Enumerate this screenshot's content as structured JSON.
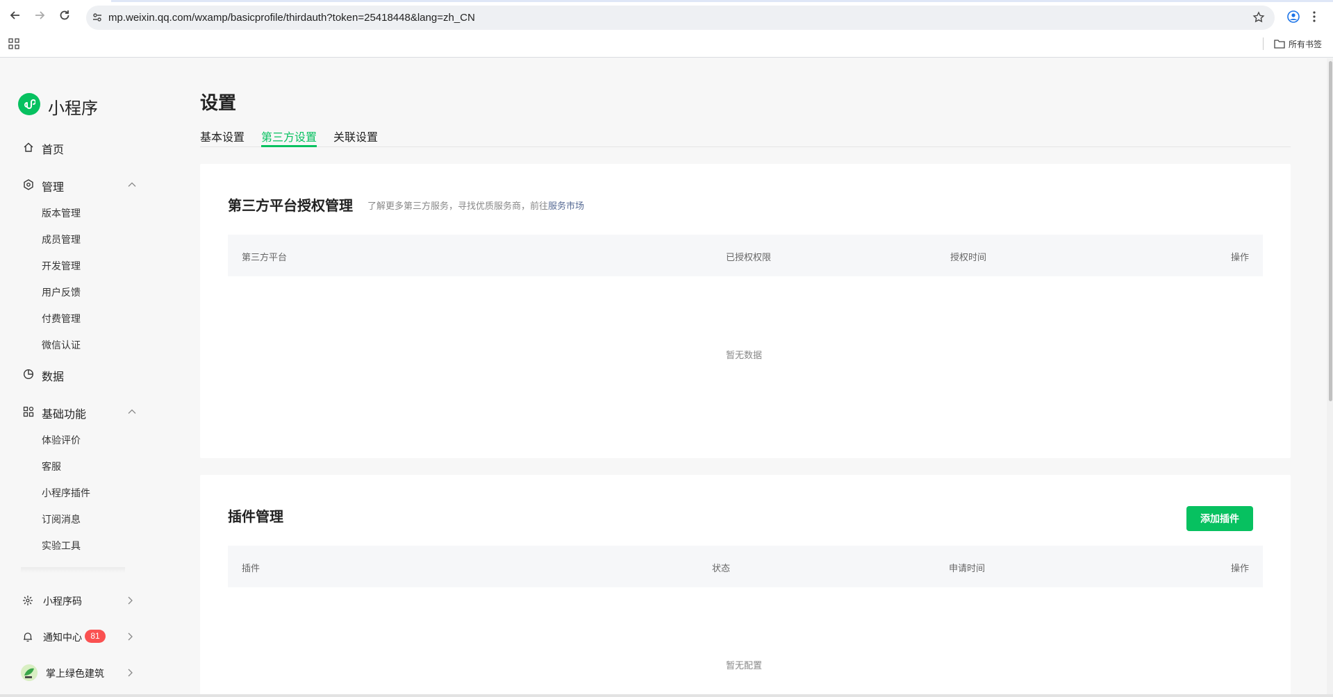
{
  "browser": {
    "url": "mp.weixin.qq.com/wxamp/basicprofile/thirdauth?token=25418448&lang=zh_CN",
    "bookmarks_label": "所有书签"
  },
  "sidebar": {
    "logo_text": "小程序",
    "home": "首页",
    "manage": {
      "label": "管理",
      "items": [
        "版本管理",
        "成员管理",
        "开发管理",
        "用户反馈",
        "付费管理",
        "微信认证"
      ]
    },
    "data": "数据",
    "basic": {
      "label": "基础功能",
      "items": [
        "体验评价",
        "客服",
        "小程序插件",
        "订阅消息",
        "实验工具"
      ]
    },
    "bottom": {
      "qrcode": "小程序码",
      "notify": "通知中心",
      "notify_count": "81",
      "account": "掌上绿色建筑"
    }
  },
  "page": {
    "title": "设置",
    "tabs": [
      "基本设置",
      "第三方设置",
      "关联设置"
    ],
    "active_tab": "第三方设置"
  },
  "third_party": {
    "title": "第三方平台授权管理",
    "desc": "了解更多第三方服务，寻找优质服务商，前往",
    "desc_link": "服务市场",
    "columns": [
      "第三方平台",
      "已授权权限",
      "授权时间",
      "操作"
    ],
    "empty": "暂无数据"
  },
  "plugins": {
    "title": "插件管理",
    "add_button": "添加插件",
    "columns": [
      "插件",
      "状态",
      "申请时间",
      "操作"
    ],
    "empty": "暂无配置"
  },
  "colors": {
    "brand": "#07c160",
    "badge": "#fa5151",
    "link": "#576b95"
  }
}
